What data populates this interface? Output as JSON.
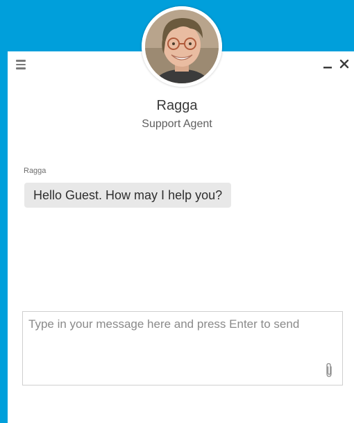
{
  "window": {
    "menu_icon": "hamburger-menu-icon",
    "minimize_icon": "minimize-icon",
    "close_icon": "close-icon"
  },
  "agent": {
    "name": "Ragga",
    "role": "Support Agent",
    "avatar_icon": "agent-avatar"
  },
  "messages": [
    {
      "sender": "Ragga",
      "text": "Hello Guest. How may I help you?"
    }
  ],
  "composer": {
    "placeholder": "Type in your message here and press Enter to send",
    "value": "",
    "attach_icon": "paperclip-icon"
  },
  "colors": {
    "background": "#009fdb",
    "panel": "#ffffff",
    "bubble": "#e8e8e8",
    "text": "#2f2f2f",
    "muted": "#8a8a8a"
  }
}
